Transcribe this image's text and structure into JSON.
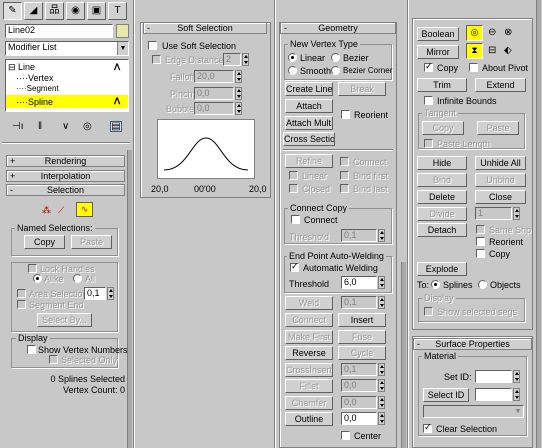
{
  "tabs": [
    {
      "icon": "create-icon"
    },
    {
      "icon": "modify-icon"
    },
    {
      "icon": "hierarchy-icon"
    },
    {
      "icon": "motion-icon"
    },
    {
      "icon": "display-icon"
    },
    {
      "icon": "utilities-icon"
    }
  ],
  "object_name": "Line02",
  "modifier_list": "Modifier List",
  "stack": {
    "items": [
      "Line",
      "Vertex",
      "Segment",
      "Spline"
    ]
  },
  "rollouts": {
    "rendering": "Rendering",
    "interpolation": "Interpolation",
    "selection": "Selection",
    "soft": "Soft Selection",
    "geometry": "Geometry",
    "surface": "Surface Properties"
  },
  "selection": {
    "named": "Named Selections:",
    "copy": "Copy",
    "paste": "Paste",
    "lock": "Lock Handles",
    "alike": "Alike",
    "all": "All",
    "area": "Area Selection:",
    "area_val": "0,1",
    "seg_end": "Segment End",
    "select_by": "Select By...",
    "display": "Display",
    "show_vn": "Show Vertex Numbers",
    "sel_only": "Selected Only",
    "status1": "0 Splines Selected",
    "status2": "Vertex Count: 0"
  },
  "soft": {
    "use": "Use Soft Selection",
    "edge": "Edge Distance:",
    "edge_val": "2",
    "falloff": "Falloff:",
    "falloff_val": "20,0",
    "pinch": "Pinch:",
    "pinch_val": "0,0",
    "bubble": "Bubble:",
    "bubble_val": "0,0",
    "ax_left": "20,0",
    "ax_mid": "00'00",
    "ax_right": "20,0"
  },
  "geom": {
    "nvt": "New Vertex Type",
    "linear": "Linear",
    "bezier": "Bezier",
    "smooth": "Smooth",
    "bezier_corner": "Bezier Corner",
    "create_line": "Create Line",
    "break": "Break",
    "attach": "Attach",
    "reorient": "Reorient",
    "attach_mult": "Attach Mult.",
    "cross": "Cross Section",
    "refine": "Refine",
    "connect": "Connect",
    "linear2": "Linear",
    "bind_first": "Bind first",
    "closed": "Closed",
    "bind_last": "Bind last",
    "connect_copy": "Connect Copy",
    "connect2": "Connect",
    "threshold": "Threshold",
    "threshold_val": "0,1",
    "epaw": "End Point Auto-Welding",
    "auto_weld": "Automatic Welding",
    "threshold2": "Threshold",
    "threshold2_val": "6,0",
    "weld": "Weld",
    "weld_val": "0,1",
    "connect3": "Connect",
    "insert": "Insert",
    "make_first": "Make First",
    "fuse": "Fuse",
    "reverse": "Reverse",
    "cycle": "Cycle",
    "crossinsert": "CrossInsert",
    "crossinsert_val": "0,1",
    "fillet": "Fillet",
    "fillet_val": "0,0",
    "chamfer": "Chamfer",
    "chamfer_val": "0,0",
    "outline": "Outline",
    "outline_val": "0,0",
    "center": "Center"
  },
  "right": {
    "boolean": "Boolean",
    "mirror": "Mirror",
    "copy": "Copy",
    "about_pivot": "About Pivot",
    "trim": "Trim",
    "extend": "Extend",
    "infinite": "Infinite Bounds",
    "tangent": "Tangent",
    "copy2": "Copy",
    "paste": "Paste",
    "paste_len": "Paste Length",
    "hide": "Hide",
    "unhide_all": "Unhide All",
    "bind": "Bind",
    "unbind": "Unbind",
    "delete": "Delete",
    "close": "Close",
    "divide": "Divide",
    "divide_val": "1",
    "detach": "Detach",
    "same_shp": "Same Shp",
    "reorient": "Reorient",
    "copy3": "Copy",
    "explode": "Explode",
    "to": "To:",
    "splines": "Splines",
    "objects": "Objects",
    "display": "Display",
    "show_segs": "Show selected segs"
  },
  "surface": {
    "material": "Material",
    "set_id": "Set ID:",
    "select_id": "Select ID",
    "clear_sel": "Clear Selection"
  },
  "colors": {
    "highlight": "#ffff00",
    "panel": "#c8c8c8"
  }
}
